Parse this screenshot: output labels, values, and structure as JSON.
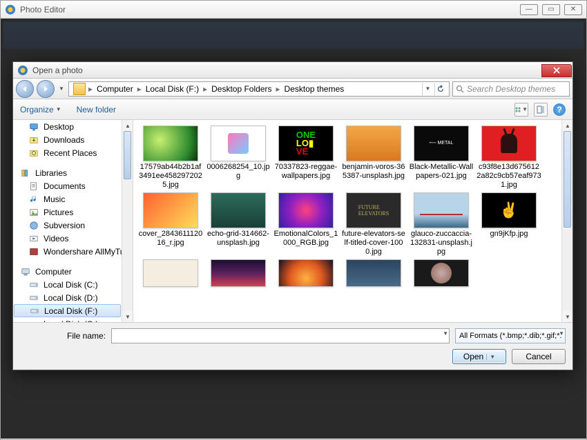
{
  "app": {
    "title": "Photo Editor"
  },
  "dialog": {
    "title": "Open a photo",
    "close_tooltip": "Close"
  },
  "breadcrumb": {
    "items": [
      "Computer",
      "Local Disk (F:)",
      "Desktop Folders",
      "Desktop themes"
    ]
  },
  "search": {
    "placeholder": "Search Desktop themes"
  },
  "toolbar": {
    "organize": "Organize",
    "newfolder": "New folder"
  },
  "sidebar": {
    "favorites": [
      {
        "label": "Desktop",
        "icon": "desktop"
      },
      {
        "label": "Downloads",
        "icon": "downloads"
      },
      {
        "label": "Recent Places",
        "icon": "recent"
      }
    ],
    "libraries_label": "Libraries",
    "libraries": [
      {
        "label": "Documents",
        "icon": "documents"
      },
      {
        "label": "Music",
        "icon": "music"
      },
      {
        "label": "Pictures",
        "icon": "pictures"
      },
      {
        "label": "Subversion",
        "icon": "subversion"
      },
      {
        "label": "Videos",
        "icon": "videos"
      },
      {
        "label": "Wondershare AllMyTube",
        "icon": "wondershare"
      }
    ],
    "computer_label": "Computer",
    "drives": [
      {
        "label": "Local Disk (C:)"
      },
      {
        "label": "Local Disk (D:)"
      },
      {
        "label": "Local Disk (F:)",
        "selected": true
      },
      {
        "label": "Local Disk (G:)"
      }
    ]
  },
  "files": [
    {
      "name": "17579ab44b2b1af3491ee4582972025.jpg",
      "thumb": "t0"
    },
    {
      "name": "0006268254_10.jpg",
      "thumb": "t1"
    },
    {
      "name": "70337823-reggae-wallpapers.jpg",
      "thumb": "t2"
    },
    {
      "name": "benjamin-voros-365387-unsplash.jpg",
      "thumb": "t3"
    },
    {
      "name": "Black-Metallic-Wallpapers-021.jpg",
      "thumb": "t4"
    },
    {
      "name": "c93f8e13d6756122a82c9cb57eaf9731.jpg",
      "thumb": "t5"
    },
    {
      "name": "cover_284361112016_r.jpg",
      "thumb": "t6"
    },
    {
      "name": "echo-grid-314662-unsplash.jpg",
      "thumb": "t7"
    },
    {
      "name": "EmotionalColors_1000_RGB.jpg",
      "thumb": "t8"
    },
    {
      "name": "future-elevators-self-titled-cover-1000.jpg",
      "thumb": "t9"
    },
    {
      "name": "glauco-zuccaccia-132831-unsplash.jpg",
      "thumb": "t10"
    },
    {
      "name": "gn9jKfp.jpg",
      "thumb": "t11"
    }
  ],
  "files_partial": [
    "tp0",
    "tp1",
    "tp2",
    "tp3",
    "tp4"
  ],
  "bottom": {
    "filename_label": "File name:",
    "filename_value": "",
    "filter": "All Formats (*.bmp;*.dib;*.gif;*.",
    "open": "Open",
    "cancel": "Cancel"
  }
}
